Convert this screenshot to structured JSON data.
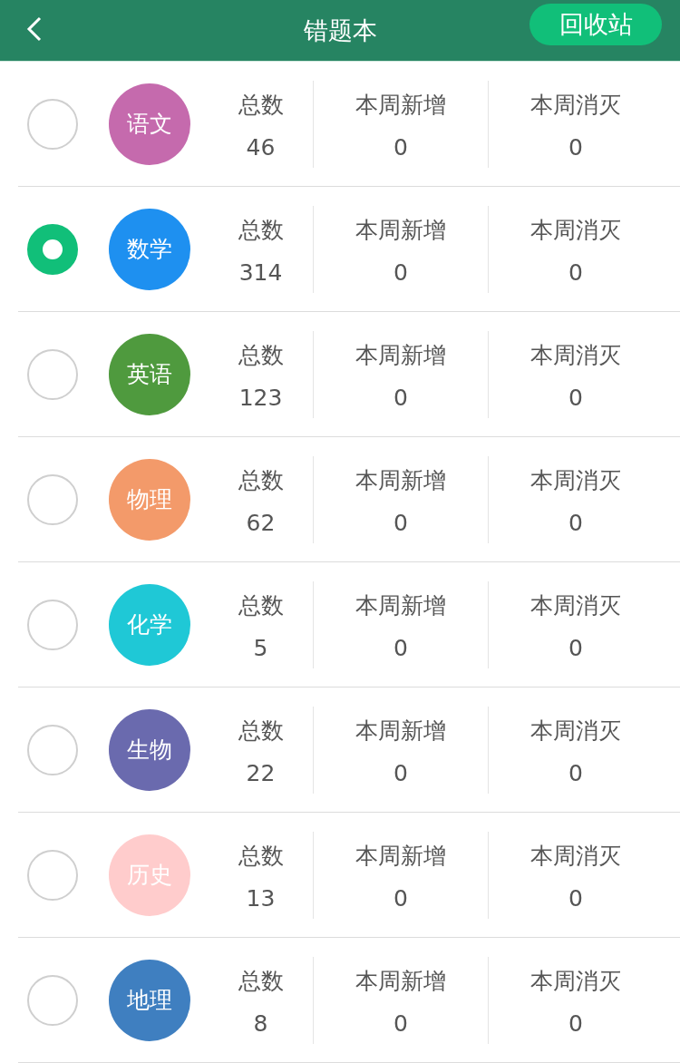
{
  "header": {
    "title": "错题本",
    "action": "回收站"
  },
  "subjects": [
    {
      "name": "语文",
      "color": "#c56aad",
      "selected": false,
      "stats": [
        {
          "label": "总数",
          "value": "46"
        },
        {
          "label": "本周新增",
          "value": "0"
        },
        {
          "label": "本周消灭",
          "value": "0"
        }
      ]
    },
    {
      "name": "数学",
      "color": "#1e90f0",
      "selected": true,
      "stats": [
        {
          "label": "总数",
          "value": "314"
        },
        {
          "label": "本周新增",
          "value": "0"
        },
        {
          "label": "本周消灭",
          "value": "0"
        }
      ]
    },
    {
      "name": "英语",
      "color": "#4f9a3e",
      "selected": false,
      "stats": [
        {
          "label": "总数",
          "value": "123"
        },
        {
          "label": "本周新增",
          "value": "0"
        },
        {
          "label": "本周消灭",
          "value": "0"
        }
      ]
    },
    {
      "name": "物理",
      "color": "#f39a6a",
      "selected": false,
      "stats": [
        {
          "label": "总数",
          "value": "62"
        },
        {
          "label": "本周新增",
          "value": "0"
        },
        {
          "label": "本周消灭",
          "value": "0"
        }
      ]
    },
    {
      "name": "化学",
      "color": "#1fc8d6",
      "selected": false,
      "stats": [
        {
          "label": "总数",
          "value": "5"
        },
        {
          "label": "本周新增",
          "value": "0"
        },
        {
          "label": "本周消灭",
          "value": "0"
        }
      ]
    },
    {
      "name": "生物",
      "color": "#6a6aae",
      "selected": false,
      "stats": [
        {
          "label": "总数",
          "value": "22"
        },
        {
          "label": "本周新增",
          "value": "0"
        },
        {
          "label": "本周消灭",
          "value": "0"
        }
      ]
    },
    {
      "name": "历史",
      "color": "#ffcccc",
      "selected": false,
      "stats": [
        {
          "label": "总数",
          "value": "13"
        },
        {
          "label": "本周新增",
          "value": "0"
        },
        {
          "label": "本周消灭",
          "value": "0"
        }
      ]
    },
    {
      "name": "地理",
      "color": "#3f7fc0",
      "selected": false,
      "stats": [
        {
          "label": "总数",
          "value": "8"
        },
        {
          "label": "本周新增",
          "value": "0"
        },
        {
          "label": "本周消灭",
          "value": "0"
        }
      ]
    }
  ]
}
